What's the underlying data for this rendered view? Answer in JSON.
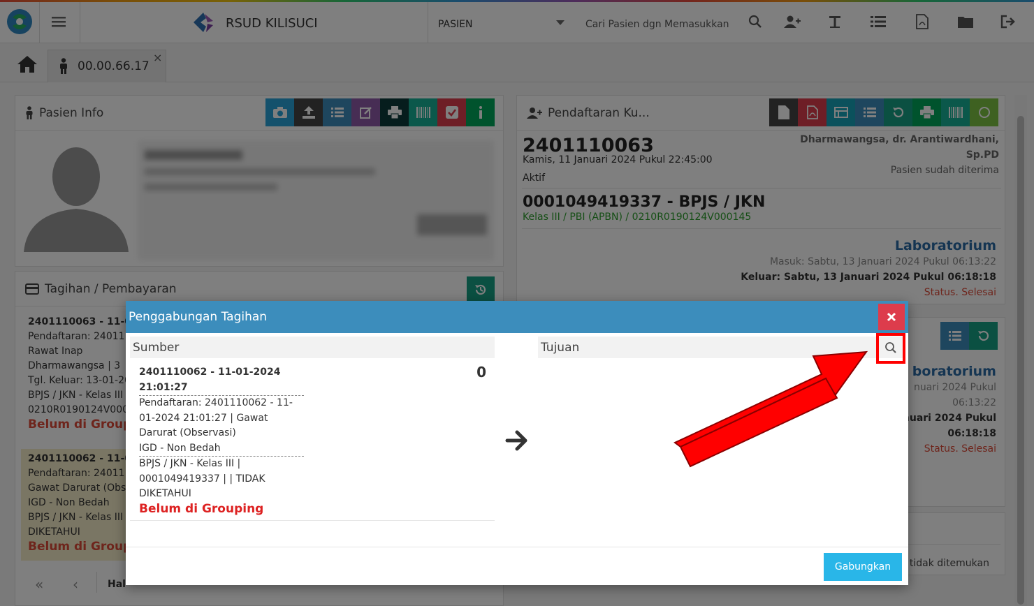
{
  "topbar": {
    "hospital_name": "RSUD KILISUCI",
    "search_category": "PASIEN",
    "search_placeholder": "Cari Pasien dgn Memasukkan"
  },
  "tabs": {
    "patient_tab_label": "00.00.66.17",
    "close_symbol": "×"
  },
  "pasien_info": {
    "title": "Pasien Info"
  },
  "tagihan": {
    "title": "Tagihan / Pembayaran",
    "items": [
      {
        "line1": "2401110063 - 11-01-",
        "line2": "Pendaftaran: 24011",
        "line3": "Rawat Inap",
        "line4": "Dharmawangsa | 3",
        "line5": "Tgl. Keluar: 13-01-20",
        "line6": "BPJS / JKN - Kelas III",
        "line7": "0210R0190124V000",
        "status": "Belum di Groupi"
      },
      {
        "line1": "2401110062 - 11-01-",
        "line2": "Pendaftaran: 24011",
        "line3": "Gawat Darurat (Obs",
        "line4": "IGD - Non Bedah",
        "line5": "BPJS / JKN - Kelas III",
        "line6": "DIKETAHUI",
        "status": "Belum di Groupi"
      }
    ],
    "pager_label": "Hal"
  },
  "pendaftaran": {
    "title": "Pendaftaran Ku...",
    "reg_no": "2401110063",
    "reg_date": "Kamis, 11 Januari 2024 Pukul 22:45:00",
    "status": "Aktif",
    "doctor_line1": "Dharmawangsa, dr. Arantiwardhani,",
    "doctor_line2": "Sp.PD",
    "accepted": "Pasien sudah diterima",
    "insurance_no": "0001049419337 - BPJS / JKN",
    "class_line": "Kelas III / PBI (APBN) / 0210R0190124V000145",
    "unit": "Laboratorium",
    "masuk": "Masuk: Sabtu, 13 Januari 2024 Pukul 06:13:22",
    "keluar": "Keluar: Sabtu, 13 Januari 2024 Pukul 06:18:18",
    "unit_status": "Status. Selesai"
  },
  "pendaftaran2": {
    "unit": "boratorium",
    "line1": "nuari 2024 Pukul",
    "line2": "06:13:22",
    "line3": "nuari 2024 Pukul",
    "line4": "06:18:18",
    "status": "Status. Selesai",
    "not_found": "tidak ditemukan"
  },
  "modal": {
    "title": "Penggabungan Tagihan",
    "sumber_label": "Sumber",
    "tujuan_label": "Tujuan",
    "source_header_1": "2401110062 - 11-01-2024",
    "source_header_2": "21:01:27",
    "source_amount": "0",
    "source_reg_1": "Pendaftaran: 2401110062 - 11-",
    "source_reg_2": "01-2024 21:01:27 | Gawat",
    "source_reg_3": "Darurat (Observasi)",
    "source_reg_4": "IGD - Non Bedah",
    "source_ins_1": "BPJS / JKN - Kelas III |",
    "source_ins_2": "0001049419337 | | TIDAK",
    "source_ins_3": "DIKETAHUI",
    "source_status": "Belum di Grouping",
    "merge_button": "Gabungkan"
  },
  "colors": {
    "header_blue": "#3c8dbc",
    "danger_red": "#dd4b39",
    "success_green": "#00a65a",
    "info_blue": "#29a3d9",
    "annotation_red": "#ff0000"
  }
}
